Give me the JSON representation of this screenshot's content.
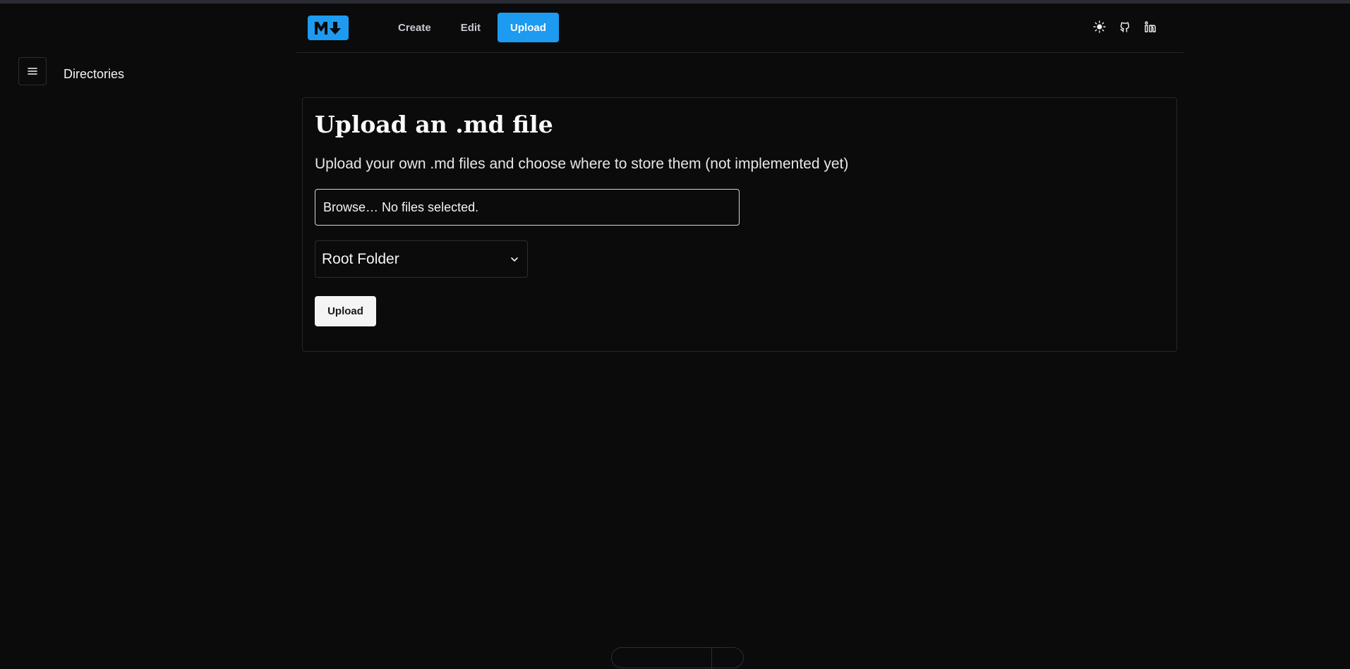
{
  "header": {
    "logo_icon": "markdown-logo-icon",
    "nav": {
      "create_label": "Create",
      "edit_label": "Edit",
      "upload_label": "Upload"
    },
    "active_tab": "Upload",
    "icons": [
      "sun-icon",
      "github-icon",
      "linkedin-icon"
    ],
    "accent_color": "#1d9bf0"
  },
  "sidebar": {
    "menu_icon": "hamburger-menu-icon",
    "title": "Directories"
  },
  "main": {
    "title": "Upload an .md file",
    "description": "Upload your own .md files and choose where to store them (not implemented yet)",
    "file_input": {
      "button_label": "Browse…",
      "status": "No files selected."
    },
    "folder_select": {
      "selected": "Root Folder"
    },
    "upload_button_label": "Upload"
  }
}
